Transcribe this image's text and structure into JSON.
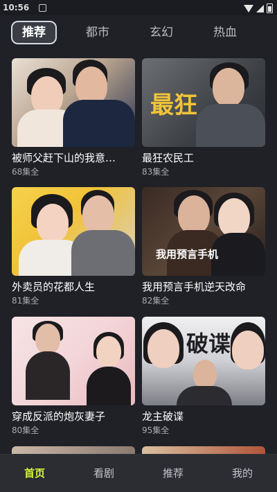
{
  "status_bar": {
    "time": "10:56"
  },
  "tabs": [
    {
      "label": "推荐"
    },
    {
      "label": "都市"
    },
    {
      "label": "玄幻"
    },
    {
      "label": "热血"
    }
  ],
  "cards": [
    {
      "title": "被师父赶下山的我意…",
      "episodes": "68集全"
    },
    {
      "title": "最狂农民工",
      "episodes": "83集全",
      "poster_text": "最狂"
    },
    {
      "title": "外卖员的花都人生",
      "episodes": "81集全"
    },
    {
      "title": "我用预言手机逆天改命",
      "episodes": "82集全",
      "poster_text": "我用预言手机"
    },
    {
      "title": "穿成反派的炮灰妻子",
      "episodes": "80集全"
    },
    {
      "title": "龙主破谍",
      "episodes": "95集全",
      "poster_text": "破谍"
    }
  ],
  "bottom_nav": [
    {
      "label": "首页"
    },
    {
      "label": "看剧"
    },
    {
      "label": "推荐"
    },
    {
      "label": "我的"
    }
  ],
  "colors": {
    "accent": "#d7f23c",
    "background": "#1f2126"
  }
}
